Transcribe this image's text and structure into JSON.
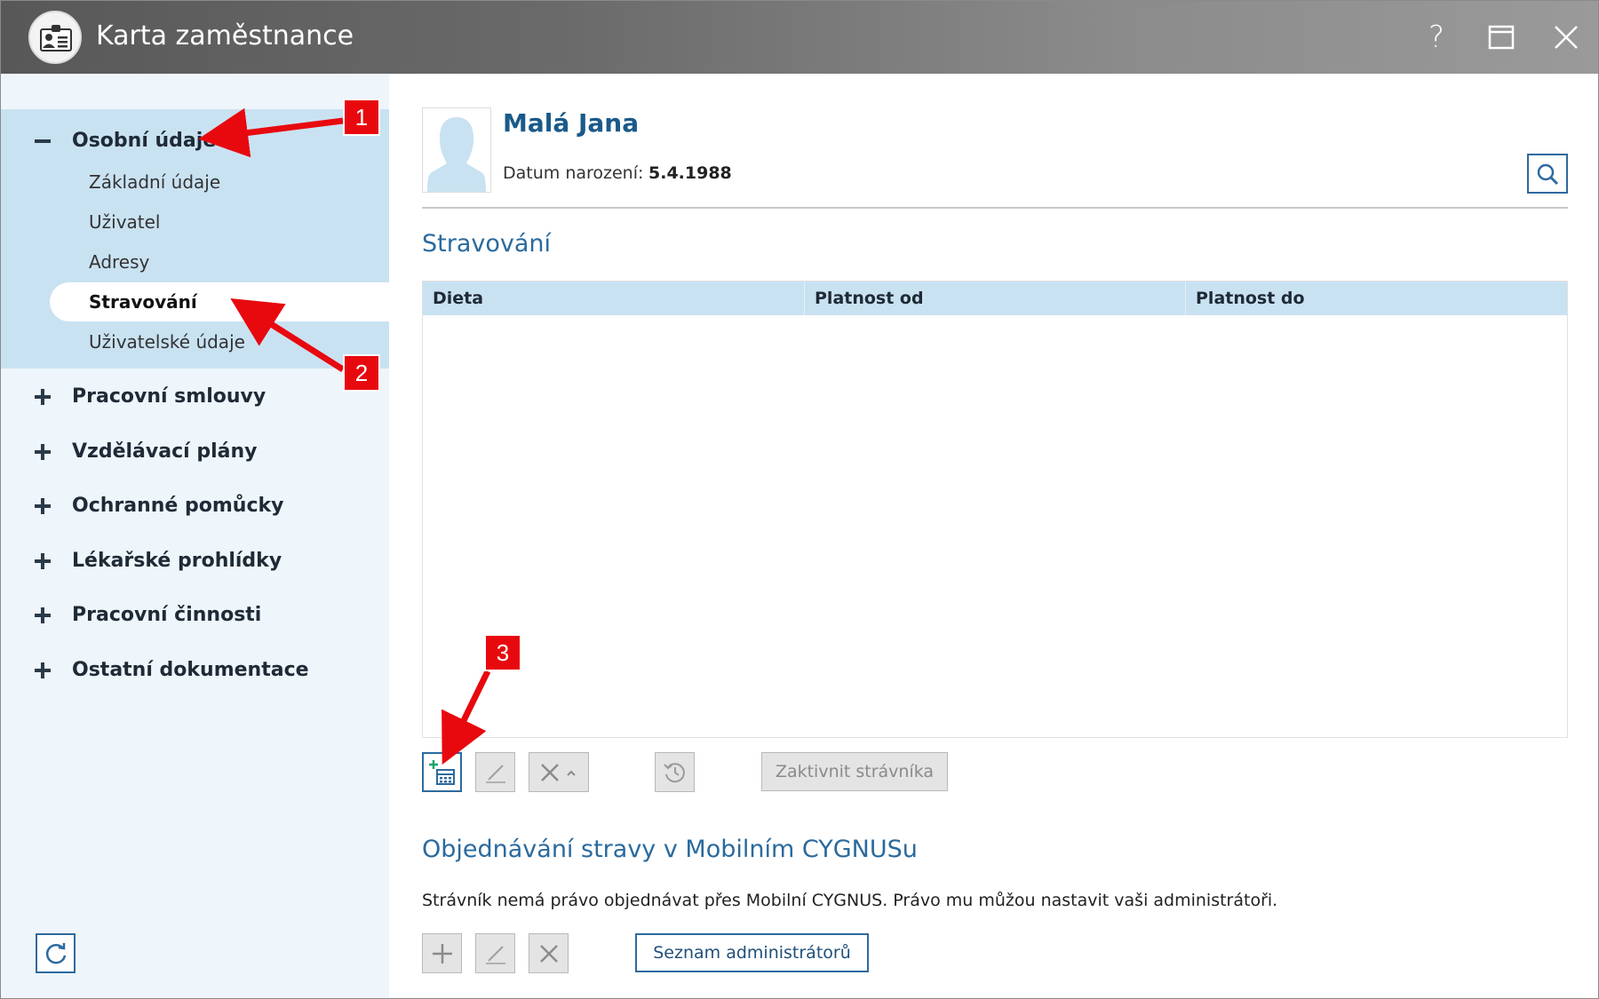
{
  "window": {
    "title": "Karta zaměstnance",
    "help_symbol": "?"
  },
  "sidebar": {
    "groups": [
      {
        "label": "Osobní údaje",
        "expanded": true
      },
      {
        "label": "Pracovní smlouvy",
        "expanded": false
      },
      {
        "label": "Vzdělávací plány",
        "expanded": false
      },
      {
        "label": "Ochranné pomůcky",
        "expanded": false
      },
      {
        "label": "Lékařské prohlídky",
        "expanded": false
      },
      {
        "label": "Pracovní činnosti",
        "expanded": false
      },
      {
        "label": "Ostatní dokumentace",
        "expanded": false
      }
    ],
    "subitems": [
      {
        "label": "Základní údaje"
      },
      {
        "label": "Uživatel"
      },
      {
        "label": "Adresy"
      },
      {
        "label": "Stravování",
        "selected": true
      },
      {
        "label": "Uživatelské údaje"
      }
    ],
    "refresh_icon": "refresh-icon"
  },
  "employee": {
    "name": "Malá Jana",
    "dob_label": "Datum narození:",
    "dob_value": "5.4.1988"
  },
  "stravovani": {
    "title": "Stravování",
    "columns": [
      "Dieta",
      "Platnost od",
      "Platnost do"
    ],
    "rows": [],
    "activate_label": "Zaktivnit strávníka"
  },
  "mobile": {
    "title": "Objednávání stravy v Mobilním CYGNUSu",
    "info": "Strávník nemá právo objednávat přes Mobilní CYGNUS. Právo mu můžou nastavit vaši administrátoři.",
    "admins_label": "Seznam administrátorů"
  },
  "annotations": [
    "1",
    "2",
    "3"
  ],
  "colors": {
    "accent": "#2e6a9e",
    "sidebar_bg": "#eef5fb",
    "sidebar_active_bg": "#c9e2f2",
    "callout": "#e8090f"
  }
}
